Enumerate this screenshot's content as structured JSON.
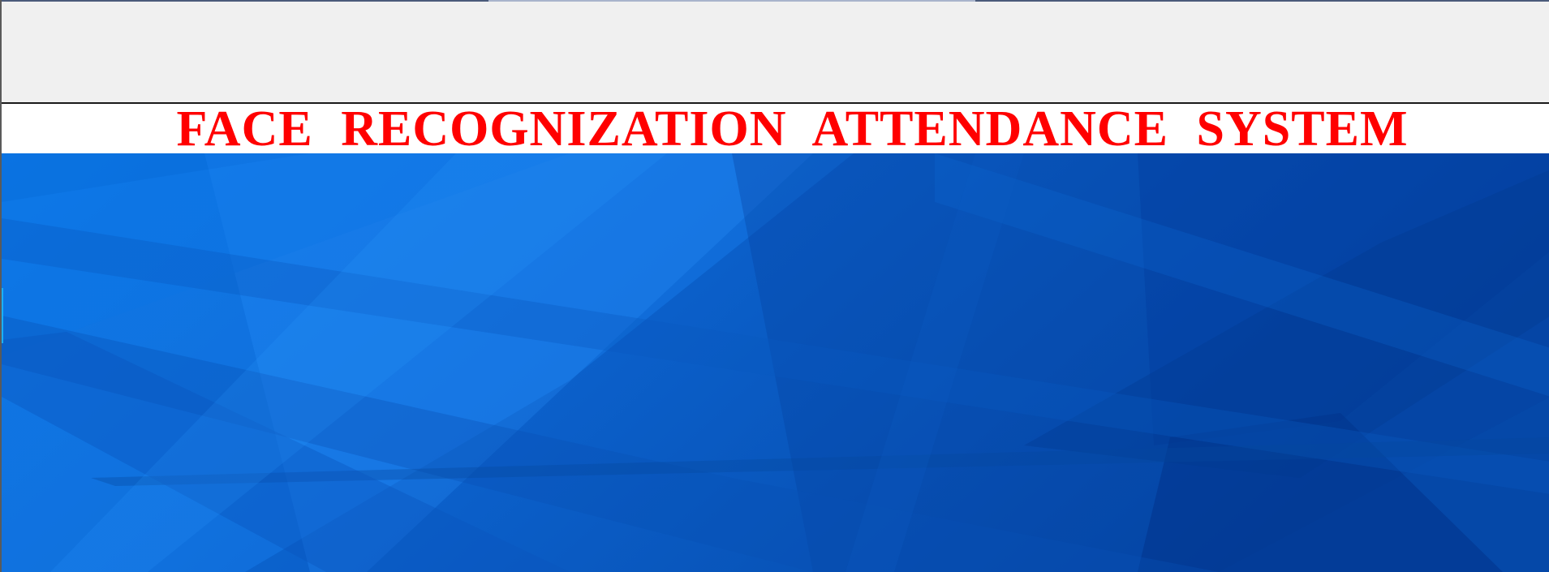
{
  "window": {
    "title_banner": "FACE RECOGNIZATION ATTENDANCE SYSTEM"
  },
  "theme": {
    "title_color": "#ff0000",
    "title_bar_background": "#ffffff",
    "background_base": "#0a63cc",
    "top_area_background": "#f0f0f0"
  },
  "background_image": {
    "icon": "abstract-blue-geometric-background"
  }
}
